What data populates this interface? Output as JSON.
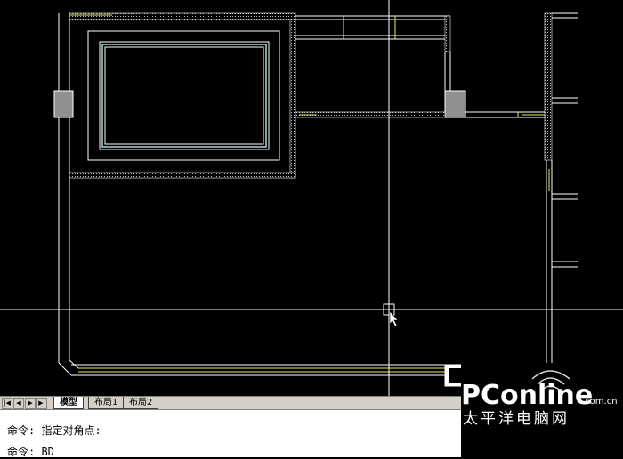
{
  "layout_tabs": [
    {
      "label": "模型",
      "active": true
    },
    {
      "label": "布局1",
      "active": false
    },
    {
      "label": "布局2",
      "active": false
    }
  ],
  "nav_buttons": [
    "|◀",
    "◀",
    "▶",
    "▶|"
  ],
  "command": {
    "line1": "命令: 指定对角点:",
    "line2": "命令: BD"
  },
  "watermark": {
    "brand": "PConline",
    "domain": ".com.cn",
    "slogan": "太平洋电脑网"
  },
  "colors": {
    "background": "#000000",
    "wall": "#ffffff",
    "window": "#e8f060",
    "inner_frame": "#a8d8d8",
    "column": "#909090",
    "crosshair": "#ffffff"
  }
}
